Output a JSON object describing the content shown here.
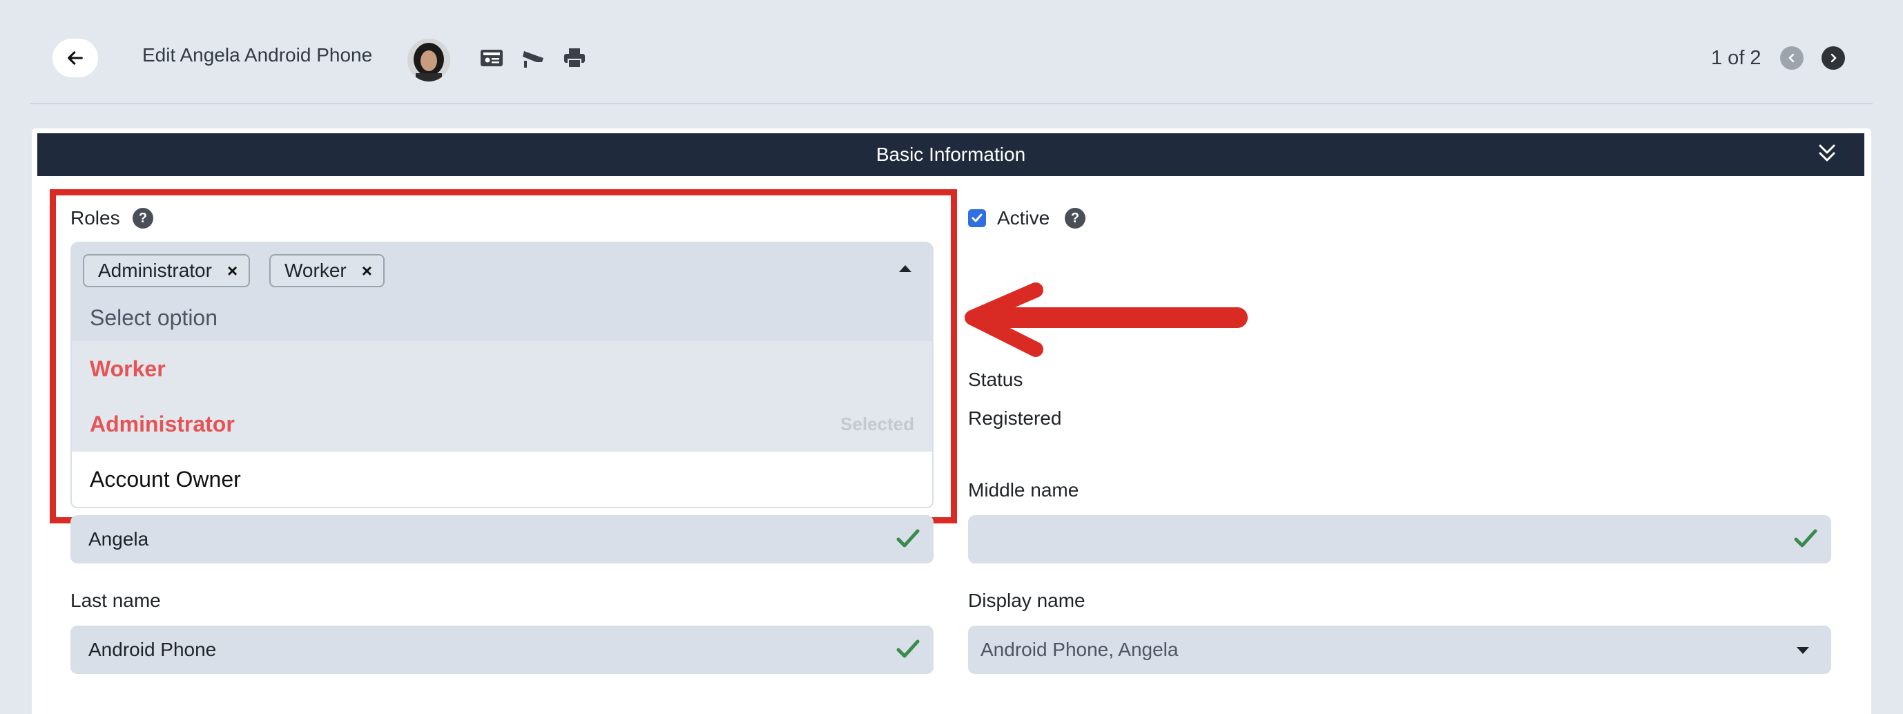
{
  "header": {
    "title": "Edit Angela Android Phone",
    "pager": "1 of 2",
    "icons": [
      "back-arrow-icon",
      "id-card-icon",
      "cctv-camera-icon",
      "printer-icon",
      "chevron-left-icon",
      "chevron-right-icon"
    ]
  },
  "section": {
    "title": "Basic Information"
  },
  "roles": {
    "label": "Roles",
    "chips": [
      "Administrator",
      "Worker"
    ],
    "placeholder": "Select option",
    "options": [
      {
        "label": "Worker",
        "selected_tag": ""
      },
      {
        "label": "Administrator",
        "selected_tag": "Selected"
      },
      {
        "label": "Account Owner",
        "selected_tag": ""
      }
    ]
  },
  "active": {
    "label": "Active",
    "checked": true
  },
  "status": {
    "label": "Status",
    "value": "Registered"
  },
  "first_name": {
    "value": "Angela"
  },
  "middle_name": {
    "label": "Middle name",
    "value": ""
  },
  "last_name": {
    "label": "Last name",
    "value": "Android Phone"
  },
  "display_name": {
    "label": "Display name",
    "value": "Android Phone, Angela"
  },
  "colors": {
    "header_bar": "#1f2a3c",
    "highlight": "#d92b24",
    "selected_option_text": "#e55454",
    "checkbox": "#2f6fe0",
    "valid_check": "#3a8a4e"
  }
}
